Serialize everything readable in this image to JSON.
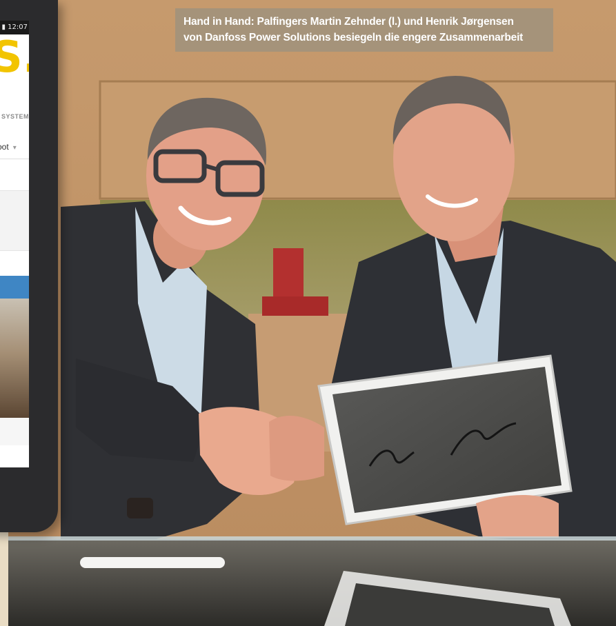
{
  "caption": {
    "line1": "Hand in Hand: Palfingers Martin Zehnder (l.) und Henrik Jørgensen",
    "line2": "von Danfoss Power Solutions besiegeln die engere Zusammenarbeit"
  },
  "phone": {
    "status_time": "12:07",
    "brand_mark": "S.",
    "brand_tagline": "SYSTEM",
    "select_value": "oot"
  },
  "colors": {
    "wood_wall": "#c9a47a",
    "suit_dark": "#2e2f33",
    "shirt_light_blue": "#c9d9e6",
    "skin": "#e6a58a",
    "brand_yellow": "#f2c400",
    "caption_bg": "#a0927c"
  }
}
